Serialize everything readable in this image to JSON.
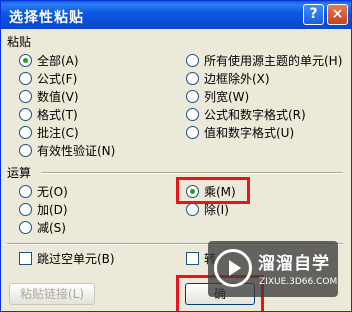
{
  "window": {
    "title": "选择性粘贴",
    "help_label": "?",
    "close_label": "×"
  },
  "paste": {
    "label": "粘贴",
    "left_options": [
      {
        "label": "全部(A)",
        "selected": true
      },
      {
        "label": "公式(F)",
        "selected": false
      },
      {
        "label": "数值(V)",
        "selected": false
      },
      {
        "label": "格式(T)",
        "selected": false
      },
      {
        "label": "批注(C)",
        "selected": false
      },
      {
        "label": "有效性验证(N)",
        "selected": false
      }
    ],
    "right_options": [
      {
        "label": "所有使用源主题的单元(H)",
        "selected": false
      },
      {
        "label": "边框除外(X)",
        "selected": false
      },
      {
        "label": "列宽(W)",
        "selected": false
      },
      {
        "label": "公式和数字格式(R)",
        "selected": false
      },
      {
        "label": "值和数字格式(U)",
        "selected": false
      }
    ]
  },
  "operation": {
    "label": "运算",
    "left_options": [
      {
        "label": "无(O)",
        "selected": false
      },
      {
        "label": "加(D)",
        "selected": false
      },
      {
        "label": "减(S)",
        "selected": false
      }
    ],
    "right_options": [
      {
        "label": "乘(M)",
        "selected": true
      },
      {
        "label": "除(I)",
        "selected": false
      }
    ]
  },
  "checkboxes": {
    "skip_blanks": "跳过空单元(B)",
    "transpose": "转"
  },
  "buttons": {
    "paste_link": "粘贴链接(L)",
    "ok": "确"
  },
  "watermark": {
    "title": "溜溜自学",
    "url": "ZIXUE.3D66.COM"
  },
  "colors": {
    "titlebar": "#0a4fd6",
    "dialog_bg": "#ece9d8",
    "highlight": "#e8141c",
    "radio_dot": "#21a121"
  }
}
